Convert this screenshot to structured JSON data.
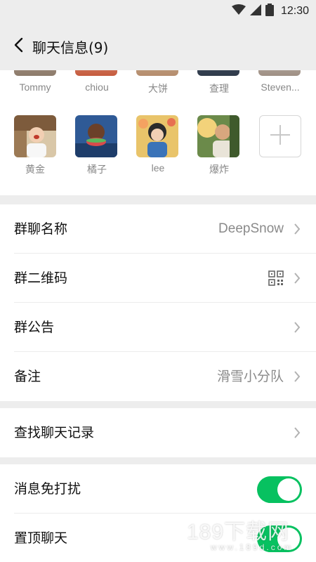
{
  "status_bar": {
    "time": "12:30",
    "icons": [
      "wifi-icon",
      "signal-icon",
      "battery-icon"
    ]
  },
  "nav": {
    "title": "聊天信息(9)",
    "back_icon": "chevron-left-icon"
  },
  "members": {
    "partial_row": [
      {
        "name": "Tommy"
      },
      {
        "name": "chiou"
      },
      {
        "name": "大饼"
      },
      {
        "name": "查理"
      },
      {
        "name": "Steven..."
      }
    ],
    "row": [
      {
        "name": "黄金"
      },
      {
        "name": "橘子"
      },
      {
        "name": "lee"
      },
      {
        "name": "爆炸"
      }
    ],
    "add_icon": "plus-icon"
  },
  "settings": {
    "group_name": {
      "label": "群聊名称",
      "value": "DeepSnow"
    },
    "group_qr": {
      "label": "群二维码",
      "icon": "qr-code-icon"
    },
    "announcement": {
      "label": "群公告"
    },
    "remark": {
      "label": "备注",
      "value": "滑雪小分队"
    },
    "search_history": {
      "label": "查找聊天记录"
    },
    "mute": {
      "label": "消息免打扰",
      "on": true
    },
    "pin": {
      "label": "置顶聊天",
      "on": true
    }
  },
  "watermark": {
    "text": "189下载网",
    "sub": "www.189d.com"
  },
  "colors": {
    "accent": "#07c160",
    "background": "#ededed",
    "card": "#ffffff",
    "secondary_text": "#888888"
  }
}
